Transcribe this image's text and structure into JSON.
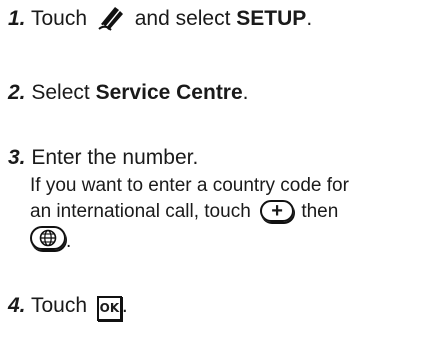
{
  "steps": [
    {
      "number": "1.",
      "text_a": "Touch",
      "text_b": "and select",
      "bold": "SETUP",
      "text_c": "."
    },
    {
      "number": "2.",
      "text_a": "Select",
      "bold": "Service Centre",
      "text_c": "."
    },
    {
      "number": "3.",
      "text_a": "Enter the number.",
      "note_line1": "If you want to enter a country code for",
      "note_line2_a": "an international call,  touch",
      "note_line2_b": "then",
      "note_line3_end": "."
    },
    {
      "number": "4.",
      "text_a": "Touch",
      "ok_label": "OK",
      "text_c": "."
    }
  ],
  "icons": {
    "pen": "pen-icon",
    "plus": "plus-icon",
    "globe": "globe-icon",
    "ok": "ok-icon"
  }
}
